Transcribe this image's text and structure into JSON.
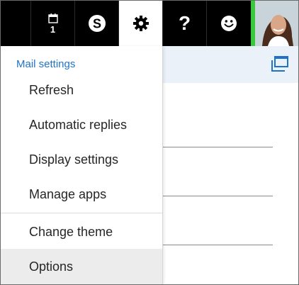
{
  "topbar": {
    "calendar": {
      "icon": "calendar-icon",
      "count": "1"
    },
    "skype": {
      "icon": "skype-icon"
    },
    "settings": {
      "icon": "gear-icon"
    },
    "help": {
      "icon": "question-icon",
      "label": "?"
    },
    "feedback": {
      "icon": "smiley-icon"
    },
    "avatar": {
      "icon": "user-avatar"
    },
    "colors": {
      "bar": "#000000",
      "active": "#ffffff",
      "status": "#3cc83c"
    }
  },
  "page": {
    "popout_icon": "popout-window-icon",
    "subbar_color": "#eaf1f8"
  },
  "menu": {
    "header": "Mail settings",
    "items": [
      {
        "label": "Refresh"
      },
      {
        "label": "Automatic replies"
      },
      {
        "label": "Display settings"
      },
      {
        "label": "Manage apps"
      },
      {
        "label": "Change theme"
      },
      {
        "label": "Options"
      }
    ],
    "accent": "#1e73c8"
  }
}
